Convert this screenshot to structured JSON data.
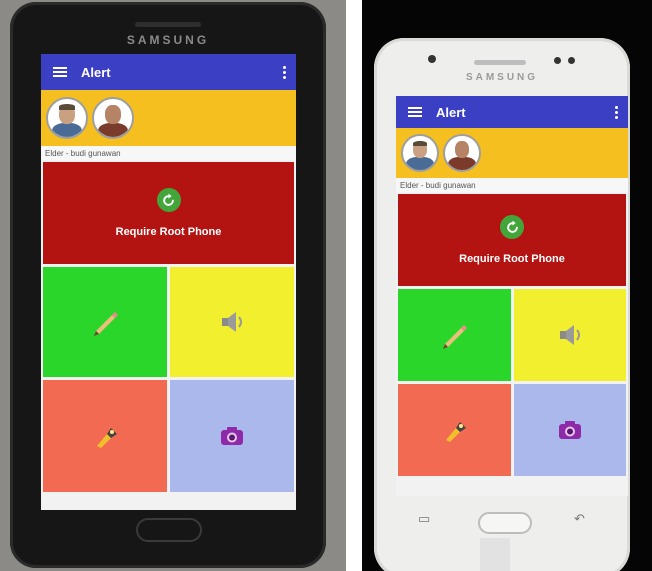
{
  "colors": {
    "appbar": "#3b3fc4",
    "contacts_bar": "#f5c01f",
    "root_tile": "#b31412",
    "green_tile": "#2bd62b",
    "yellow_tile": "#f2ef2f",
    "orange_tile": "#f36a52",
    "blue_tile": "#aab8ec"
  },
  "left_phone": {
    "brand": "SAMSUNG",
    "app_title": "Alert",
    "selected_contact": "Elder - budi gunawan",
    "root_label": "Require Root Phone"
  },
  "right_phone": {
    "brand": "SAMSUNG",
    "app_title": "Alert",
    "selected_contact": "Elder - budi gunawan",
    "root_label": "Require Root Phone"
  },
  "tiles": {
    "icons": [
      "pencil-icon",
      "speaker-icon",
      "flashlight-icon",
      "camera-icon"
    ]
  }
}
